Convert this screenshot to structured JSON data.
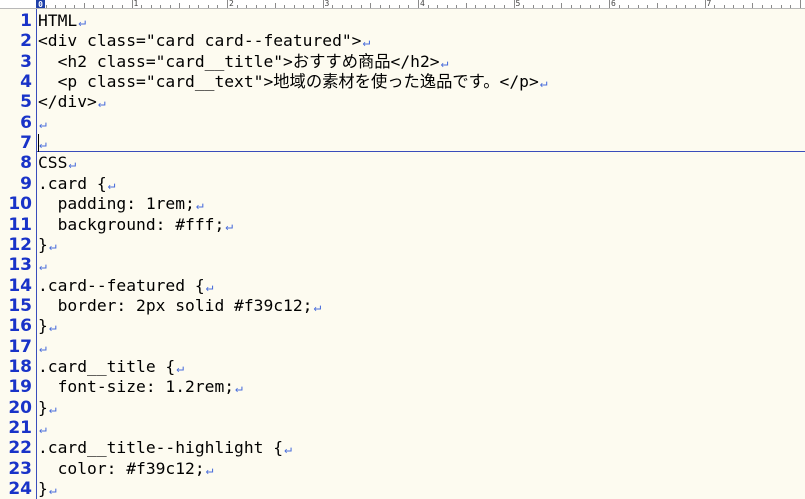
{
  "editor": {
    "ruler_marks": [
      "0",
      "1",
      "2",
      "3",
      "4",
      "5",
      "6",
      "7"
    ],
    "eol_glyph": "↵",
    "lines": [
      {
        "no": "1",
        "text": "HTML"
      },
      {
        "no": "2",
        "text": "<div class=\"card card--featured\">"
      },
      {
        "no": "3",
        "text": "  <h2 class=\"card__title\">おすすめ商品</h2>"
      },
      {
        "no": "4",
        "text": "  <p class=\"card__text\">地域の素材を使った逸品です。</p>"
      },
      {
        "no": "5",
        "text": "</div>"
      },
      {
        "no": "6",
        "text": ""
      },
      {
        "no": "7",
        "text": ""
      },
      {
        "no": "8",
        "text": "CSS"
      },
      {
        "no": "9",
        "text": ".card {"
      },
      {
        "no": "10",
        "text": "  padding: 1rem;"
      },
      {
        "no": "11",
        "text": "  background: #fff;"
      },
      {
        "no": "12",
        "text": "}"
      },
      {
        "no": "13",
        "text": ""
      },
      {
        "no": "14",
        "text": ".card--featured {"
      },
      {
        "no": "15",
        "text": "  border: 2px solid #f39c12;"
      },
      {
        "no": "16",
        "text": "}"
      },
      {
        "no": "17",
        "text": ""
      },
      {
        "no": "18",
        "text": ".card__title {"
      },
      {
        "no": "19",
        "text": "  font-size: 1.2rem;"
      },
      {
        "no": "20",
        "text": "}"
      },
      {
        "no": "21",
        "text": ""
      },
      {
        "no": "22",
        "text": ".card__title--highlight {"
      },
      {
        "no": "23",
        "text": "  color: #f39c12;"
      },
      {
        "no": "24",
        "text": "}"
      }
    ]
  },
  "colors": {
    "line_numbers": "#1933c8",
    "eol_mark": "#4a6edb",
    "background": "#fdfbf0",
    "separator": "#3a4dbb"
  }
}
